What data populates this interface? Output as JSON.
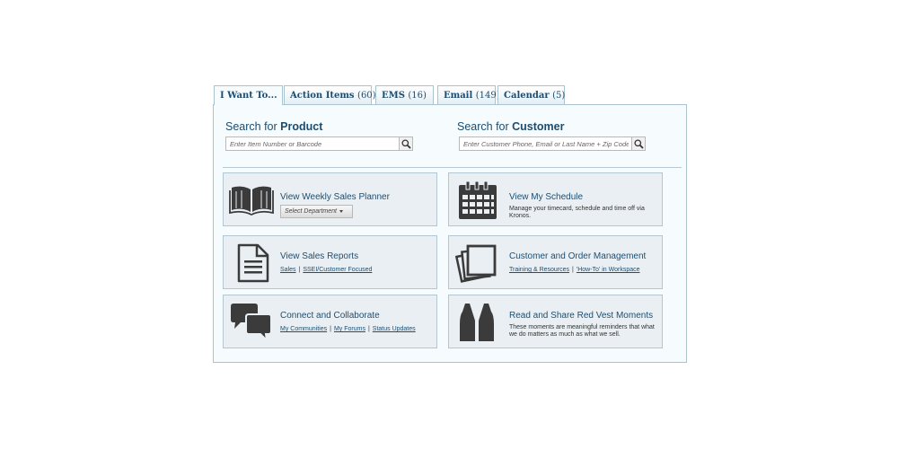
{
  "tabs": [
    {
      "label": "I Want To...",
      "count": ""
    },
    {
      "label": "Action Items",
      "count": "(60)"
    },
    {
      "label": "EMS",
      "count": "(16)"
    },
    {
      "label": "Email",
      "count": "(149)"
    },
    {
      "label": "Calendar",
      "count": "(5)"
    }
  ],
  "product_search": {
    "title_prefix": "Search for ",
    "title_bold": "Product",
    "placeholder": "Enter Item Number or Barcode"
  },
  "customer_search": {
    "title_prefix": "Search for ",
    "title_bold": "Customer",
    "placeholder": "Enter Customer Phone, Email or Last Name + Zip Code"
  },
  "cards": {
    "sales_planner": {
      "title": "View Weekly Sales Planner",
      "dropdown_label": "Select Department",
      "icon": "book-icon"
    },
    "schedule": {
      "title": "View My Schedule",
      "description": "Manage your timecard, schedule and time off via Kronos.",
      "icon": "calendar-icon"
    },
    "sales_reports": {
      "title": "View Sales Reports",
      "links": [
        "Sales",
        "SSEI/Customer Focused"
      ],
      "icon": "document-icon"
    },
    "order_mgmt": {
      "title": "Customer and Order Management",
      "links": [
        "Training & Resources",
        "'How-To' in Workspace"
      ],
      "icon": "stacked-pages-icon"
    },
    "collaborate": {
      "title": "Connect and Collaborate",
      "links": [
        "My Communities",
        "My Forums",
        "Status Updates"
      ],
      "icon": "chat-bubbles-icon"
    },
    "red_vest": {
      "title": "Read and Share Red Vest Moments",
      "description": "These moments are meaningful reminders that what we do matters as much as what we sell.",
      "icon": "vest-icon"
    }
  },
  "colors": {
    "title_blue": "#1c4d70",
    "icon_dark": "#3b3b3b",
    "card_bg": "#e9eff2",
    "panel_bg": "#f6fbfd"
  }
}
